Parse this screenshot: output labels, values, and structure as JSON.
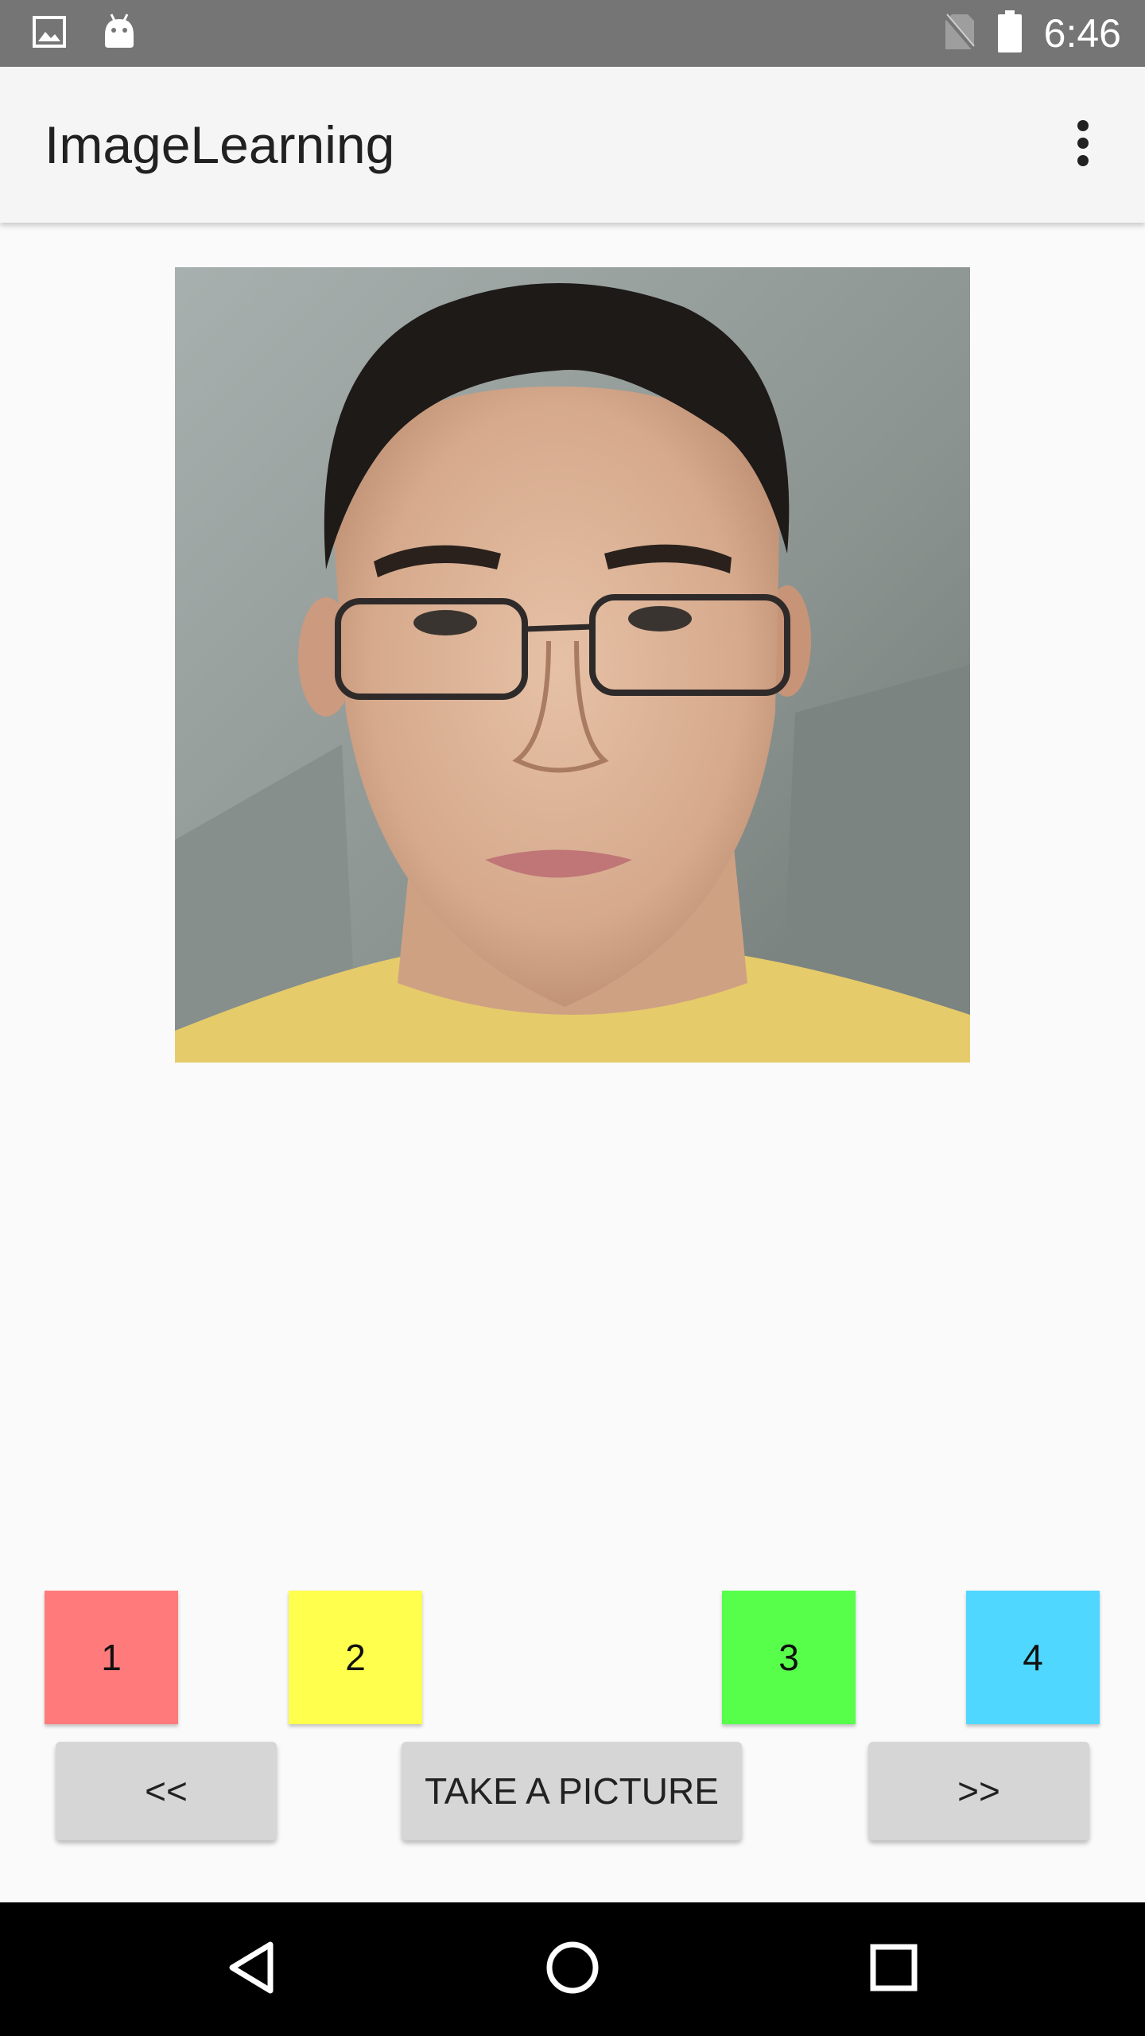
{
  "status_bar": {
    "time": "6:46",
    "icons": [
      "image-notification-icon",
      "android-debug-icon",
      "no-sim-icon",
      "battery-icon"
    ]
  },
  "app_bar": {
    "title": "ImageLearning",
    "menu_icon": "more-vert-icon"
  },
  "photo": {
    "description_icon": "captured-face-photo"
  },
  "categories": [
    {
      "label": "1",
      "color": "#ff7b7b"
    },
    {
      "label": "2",
      "color": "#ffff4d"
    },
    {
      "label": "3",
      "color": "#57ff4a"
    },
    {
      "label": "4",
      "color": "#4fd7ff"
    }
  ],
  "actions": {
    "prev_label": "<<",
    "take_picture_label": "TAKE A PICTURE",
    "next_label": ">>"
  },
  "nav_bar": {
    "back_icon": "back-triangle-icon",
    "home_icon": "home-circle-icon",
    "recents_icon": "recents-square-icon"
  },
  "colors": {
    "status_bar_bg": "#757575",
    "app_bar_bg": "#f5f5f5",
    "page_bg": "#fafafa",
    "button_bg": "#d6d6d6",
    "nav_bar_bg": "#000000"
  }
}
